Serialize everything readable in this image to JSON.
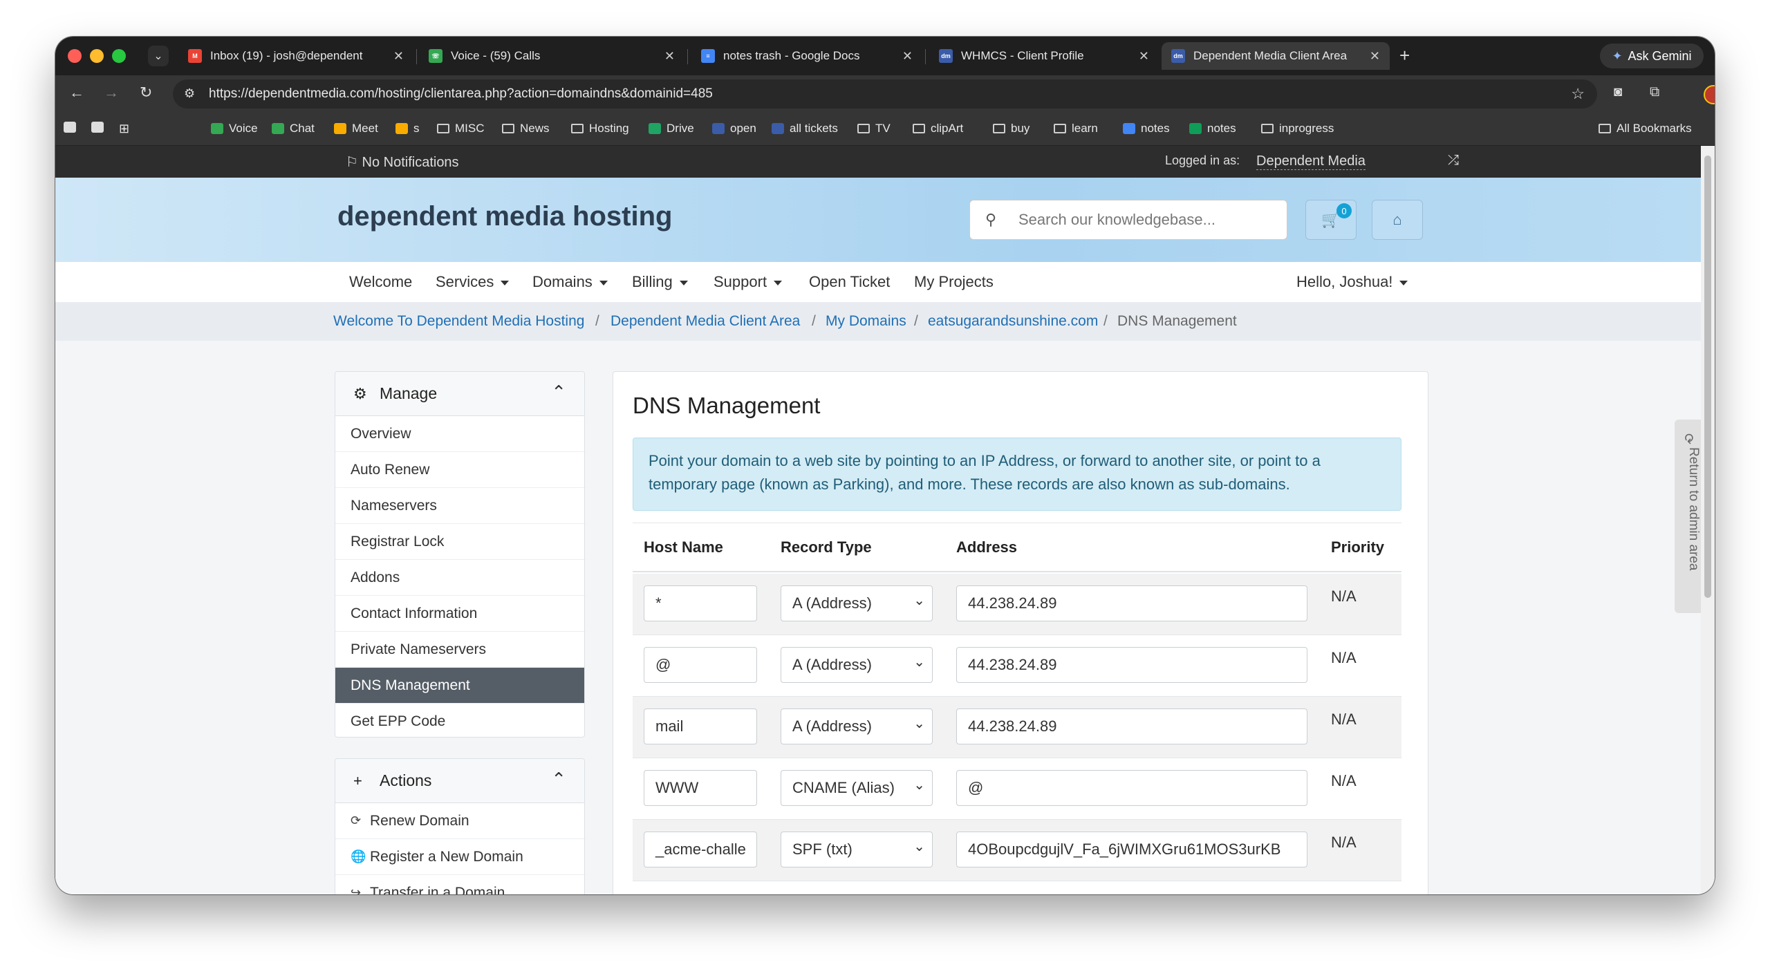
{
  "browser": {
    "tabs": [
      {
        "title": "Inbox (19) - josh@dependent",
        "fav_color": "#ea4335",
        "fav_glyph": "M"
      },
      {
        "title": "Voice - (59) Calls",
        "fav_color": "#34a853",
        "fav_glyph": "☏"
      },
      {
        "title": "notes trash - Google Docs",
        "fav_color": "#4285f4",
        "fav_glyph": "≡"
      },
      {
        "title": "WHMCS - Client Profile",
        "fav_color": "#3b5ca8",
        "fav_glyph": "dm"
      },
      {
        "title": "Dependent Media Client Area",
        "fav_color": "#3b5ca8",
        "fav_glyph": "dm"
      }
    ],
    "gemini_label": "Ask Gemini",
    "url": "https://dependentmedia.com/hosting/clientarea.php?action=domaindns&domainid=485",
    "bookmarks": [
      {
        "label": "Voice",
        "type": "app",
        "color": "#34a853"
      },
      {
        "label": "Chat",
        "type": "app",
        "color": "#34a853"
      },
      {
        "label": "Meet",
        "type": "app",
        "color": "#f9ab00"
      },
      {
        "label": "s",
        "type": "app",
        "color": "#f9ab00"
      },
      {
        "label": "MISC",
        "type": "folder"
      },
      {
        "label": "News",
        "type": "folder"
      },
      {
        "label": "Hosting",
        "type": "folder"
      },
      {
        "label": "Drive",
        "type": "app",
        "color": "#1fa463"
      },
      {
        "label": "open",
        "type": "app",
        "color": "#3b5ca8"
      },
      {
        "label": "all tickets",
        "type": "app",
        "color": "#3b5ca8"
      },
      {
        "label": "TV",
        "type": "folder"
      },
      {
        "label": "clipArt",
        "type": "folder"
      },
      {
        "label": "buy",
        "type": "folder"
      },
      {
        "label": "learn",
        "type": "folder"
      },
      {
        "label": "notes",
        "type": "app",
        "color": "#4285f4"
      },
      {
        "label": "notes",
        "type": "app",
        "color": "#0f9d58"
      },
      {
        "label": "inprogress",
        "type": "folder"
      }
    ],
    "all_bookmarks": "All Bookmarks"
  },
  "admin_bar": {
    "notifications": "No Notifications",
    "logged_in_label": "Logged in as:",
    "logged_in_user": "Dependent Media"
  },
  "header": {
    "brand": "dependent media hosting",
    "search_placeholder": "Search our knowledgebase...",
    "cart_count": "0"
  },
  "nav": {
    "items": [
      "Welcome",
      "Services",
      "Domains",
      "Billing",
      "Support",
      "Open Ticket",
      "My Projects"
    ],
    "user_greeting": "Hello, Joshua!"
  },
  "breadcrumb": [
    "Welcome To Dependent Media Hosting",
    "Dependent Media Client Area",
    "My Domains",
    "eatsugarandsunshine.com",
    "DNS Management"
  ],
  "sidebar": {
    "manage_title": "Manage",
    "manage_items": [
      "Overview",
      "Auto Renew",
      "Nameservers",
      "Registrar Lock",
      "Addons",
      "Contact Information",
      "Private Nameservers",
      "DNS Management",
      "Get EPP Code"
    ],
    "active_item": "DNS Management",
    "actions_title": "Actions",
    "action_items": [
      {
        "label": "Renew Domain",
        "icon": "renew-icon"
      },
      {
        "label": "Register a New Domain",
        "icon": "globe-icon"
      },
      {
        "label": "Transfer in a Domain",
        "icon": "share-icon"
      }
    ]
  },
  "dns": {
    "title": "DNS Management",
    "info": "Point your domain to a web site by pointing to an IP Address, or forward to another site, or point to a temporary page (known as Parking), and more. These records are also known as sub-domains.",
    "columns": [
      "Host Name",
      "Record Type",
      "Address",
      "Priority"
    ],
    "records": [
      {
        "host": "*",
        "type": "A (Address)",
        "address": "44.238.24.89",
        "priority": "N/A"
      },
      {
        "host": "@",
        "type": "A (Address)",
        "address": "44.238.24.89",
        "priority": "N/A"
      },
      {
        "host": "mail",
        "type": "A (Address)",
        "address": "44.238.24.89",
        "priority": "N/A"
      },
      {
        "host": "WWW",
        "type": "CNAME (Alias)",
        "address": "@",
        "priority": "N/A"
      },
      {
        "host": "_acme-challe",
        "type": "SPF (txt)",
        "address": "4OBoupcdgujlV_Fa_6jWIMXGru61MOS3urKB",
        "priority": "N/A"
      }
    ]
  },
  "return_admin": "Return to admin area"
}
